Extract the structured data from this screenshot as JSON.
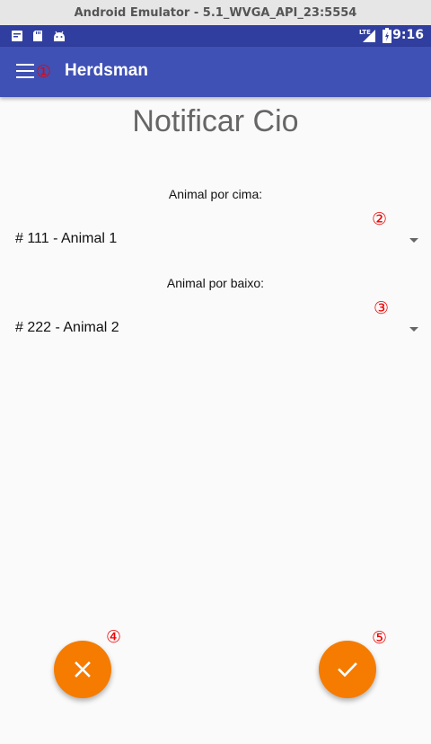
{
  "window": {
    "title": "Android Emulator - 5.1_WVGA_API_23:5554"
  },
  "status_bar": {
    "time": "9:16",
    "network": "LTE",
    "icons": [
      "notification-icon",
      "sd-card-icon",
      "android-icon",
      "lte-signal-icon",
      "battery-icon"
    ]
  },
  "app_bar": {
    "title": "Herdsman"
  },
  "annotations": [
    "①",
    "②",
    "③",
    "④",
    "⑤"
  ],
  "page": {
    "title": "Notificar Cio",
    "fields": [
      {
        "label": "Animal por cima:",
        "selected": "# 111 - Animal 1"
      },
      {
        "label": "Animal por baixo:",
        "selected": "# 222 - Animal 2"
      }
    ]
  },
  "actions": {
    "cancel_icon": "close-icon",
    "confirm_icon": "check-icon"
  },
  "colors": {
    "status_bar": "#303f9f",
    "app_bar": "#3f51b5",
    "fab": "#f57c00",
    "annotation": "#ee0000"
  }
}
